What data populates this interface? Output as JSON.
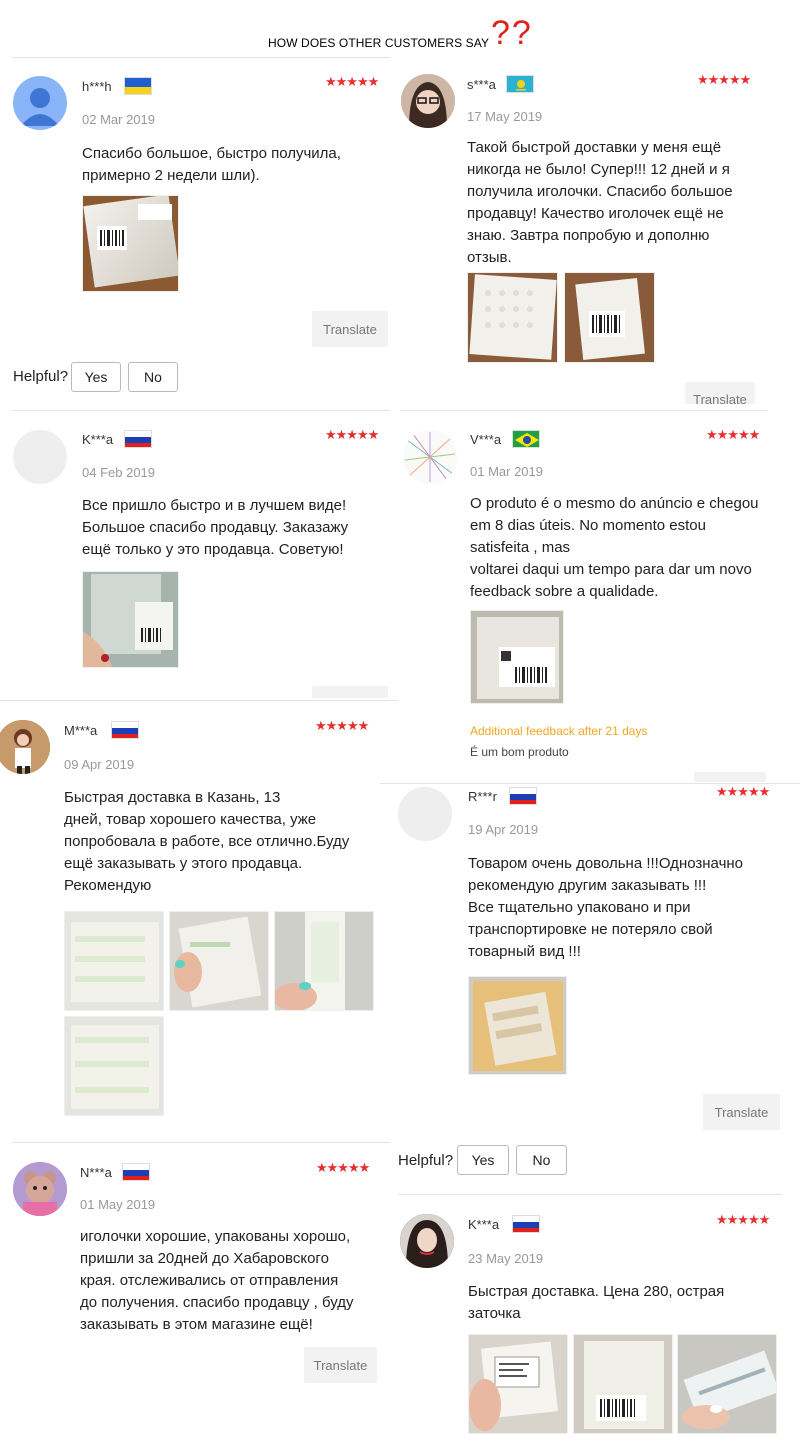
{
  "header": {
    "text": "HOW DOES OTHER CUSTOMERS SAY",
    "marks": "??"
  },
  "colors": {
    "star": "#e62e2e",
    "additional": "#f5a623",
    "date": "#999999"
  },
  "stars": "★★★★★",
  "buttons": {
    "translate": "Translate",
    "helpful": "Helpful?",
    "yes": "Yes",
    "no": "No"
  },
  "reviews": [
    {
      "name": "h***h",
      "flag": "ukraine",
      "date": "02 Mar 2019",
      "text": "Спасибо большое, быстро получила,\nпримерно 2 недели шли)."
    },
    {
      "name": "s***a",
      "flag": "kazakhstan",
      "date": "17 May 2019",
      "text": "Такой быстрой доставки у меня ещё\nникогда не было! Супер!!! 12 дней и я\nполучила иголочки. Спасибо большое\nпродавцу! Качество иголочек ещё не\nзнаю. Завтра попробую и дополню\nотзыв."
    },
    {
      "name": "K***a",
      "flag": "russia",
      "date": "04 Feb 2019",
      "text": "Все пришло быстро и в лучшем виде!\nБольшое спасибо продавцу. Заказажу\nещё только у это продавца. Советую!"
    },
    {
      "name": "V***a",
      "flag": "brazil",
      "date": "01 Mar 2019",
      "text": "O produto é o mesmo do anúncio e chegou\nem 8 dias úteis. No momento estou\nsatisfeita , mas\nvoltarei daqui um tempo para dar um novo\nfeedback sobre a qualidade.",
      "additional_label": "Additional feedback after 21 days",
      "additional_text": "É um bom produto"
    },
    {
      "name": "M***a",
      "flag": "russia",
      "date": "09 Apr 2019",
      "text": "Быстрая доставка в Казань, 13\nдней, товар хорошего качества, уже\nпопробовала в работе, все отлично.Буду\nещё заказывать у этого продавца.\nРекомендую"
    },
    {
      "name": "R***r",
      "flag": "russia",
      "date": "19 Apr 2019",
      "text": "Товаром очень довольна !!!Однозначно\nрекомендую другим заказывать !!!\nВсе тщательно упаковано и при\nтранспортировке не потеряло свой\nтоварный вид !!!"
    },
    {
      "name": "N***a",
      "flag": "russia",
      "date": "01 May 2019",
      "text": "иголочки хорошие, упакованы хорошо,\nпришли за 20дней до Хабаровского\nкрая. отслеживались от отправления\nдо получения. спасибо продавцу , буду\nзаказывать в этом магазине ещё!"
    },
    {
      "name": "K***a",
      "flag": "russia",
      "date": "23 May 2019",
      "text": "Быстрая доставка. Цена 280, острая\nзаточка"
    }
  ]
}
